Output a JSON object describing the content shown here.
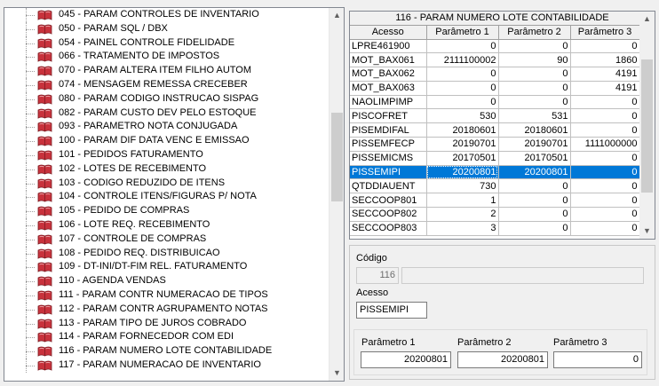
{
  "tree": {
    "items": [
      "045 - PARAM CONTROLES DE INVENTARIO",
      "050 - PARAM SQL / DBX",
      "054 - PAINEL CONTROLE FIDELIDADE",
      "066 - TRATAMENTO DE IMPOSTOS",
      "070 - PARAM ALTERA ITEM FILHO AUTOM",
      "074 - MENSAGEM REMESSA CRECEBER",
      "080 - PARAM CODIGO INSTRUCAO SISPAG",
      "082 - PARAM CUSTO DEV PELO ESTOQUE",
      "093 - PARAMETRO NOTA CONJUGADA",
      "100 - PARAM DIF DATA VENC E EMISSAO",
      "101 - PEDIDOS FATURAMENTO",
      "102 - LOTES DE RECEBIMENTO",
      "103 - CODIGO REDUZIDO DE ITENS",
      "104 - CONTROLE ITENS/FIGURAS P/ NOTA",
      "105 - PEDIDO DE COMPRAS",
      "106 - LOTE REQ. RECEBIMENTO",
      "107 - CONTROLE DE COMPRAS",
      "108 - PEDIDO REQ. DISTRIBUICAO",
      "109 - DT-INI/DT-FIM REL. FATURAMENTO",
      "110 - AGENDA VENDAS",
      "111 - PARAM CONTR NUMERACAO DE TIPOS",
      "112 - PARAM CONTR AGRUPAMENTO NOTAS",
      "113 - PARAM TIPO DE JUROS COBRADO",
      "114 - PARAM FORNECEDOR COM EDI",
      "116 - PARAM NUMERO LOTE CONTABILIDADE",
      "117 - PARAM NUMERACAO DE INVENTARIO"
    ],
    "icon": "book-icon",
    "icon_color": "#c8323c",
    "scroll_position": 0.35
  },
  "grid": {
    "caption": "116 - PARAM NUMERO LOTE CONTABILIDADE",
    "columns": [
      "Acesso",
      "Parâmetro 1",
      "Parâmetro 2",
      "Parâmetro 3"
    ],
    "rows": [
      [
        "LPRE461900",
        "0",
        "0",
        "0"
      ],
      [
        "MOT_BAX061",
        "2111100002",
        "90",
        "1860"
      ],
      [
        "MOT_BAX062",
        "0",
        "0",
        "4191"
      ],
      [
        "MOT_BAX063",
        "0",
        "0",
        "4191"
      ],
      [
        "NAOLIMPIMP",
        "0",
        "0",
        "0"
      ],
      [
        "PISCOFRET",
        "530",
        "531",
        "0"
      ],
      [
        "PISEMDIFAL",
        "20180601",
        "20180601",
        "0"
      ],
      [
        "PISSEMFECP",
        "20190701",
        "20190701",
        "1111000000"
      ],
      [
        "PISSEMICMS",
        "20170501",
        "20170501",
        "0"
      ],
      [
        "PISSEMIPI",
        "20200801",
        "20200801",
        "0"
      ],
      [
        "QTDDIAUENT",
        "730",
        "0",
        "0"
      ],
      [
        "SECCOOP801",
        "1",
        "0",
        "0"
      ],
      [
        "SECCOOP802",
        "2",
        "0",
        "0"
      ],
      [
        "SECCOOP803",
        "3",
        "0",
        "0"
      ]
    ],
    "selected_row": 9,
    "selection_color": "#0078d7",
    "scroll_position": 0.5
  },
  "detail": {
    "codigo_label": "Código",
    "codigo_value": "116",
    "acesso_label": "Acesso",
    "acesso_value": "PISSEMIPI",
    "param1_label": "Parâmetro 1",
    "param1_value": "20200801",
    "param2_label": "Parâmetro 2",
    "param2_value": "20200801",
    "param3_label": "Parâmetro 3",
    "param3_value": "0"
  }
}
